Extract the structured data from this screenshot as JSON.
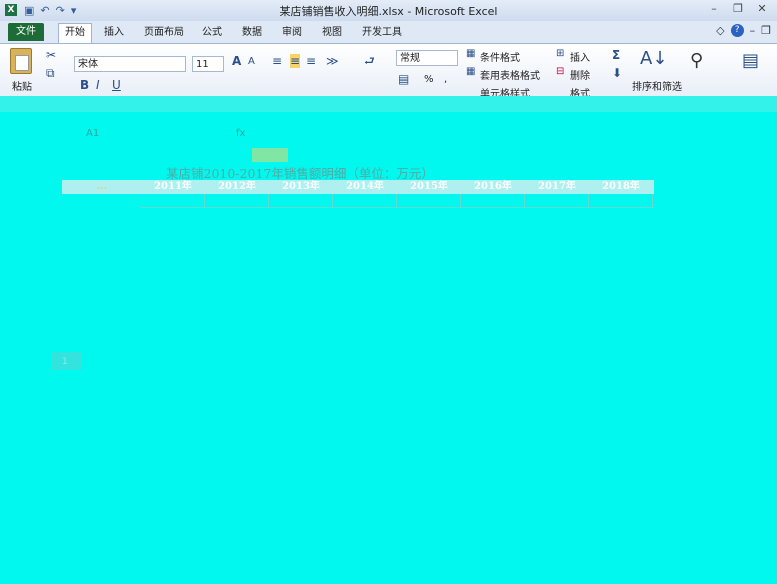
{
  "window": {
    "title": "某店铺销售收入明细.xlsx - Microsoft Excel",
    "app_icon": "X"
  },
  "qat": {
    "undo": "↶",
    "redo": "↷",
    "customize": "▾"
  },
  "tabs": [
    "文件",
    "开始",
    "插入",
    "页面布局",
    "公式",
    "数据",
    "审阅",
    "视图",
    "开发工具"
  ],
  "ribbon": {
    "paste_label": "粘贴",
    "font_name": "宋体",
    "font_size": "11",
    "number_format": "常规",
    "conditional_format": "条件格式",
    "table_format": "套用表格格式",
    "cell_style": "单元格样式",
    "insert": "插入",
    "delete": "删除",
    "format": "格式",
    "sort_filter": "排序和筛选",
    "percent": "%",
    "comma": ","
  },
  "sheet": {
    "title": "某店铺2010-2017年销售额明细（单位：万元）",
    "first_header": "...",
    "headers": [
      "2011年",
      "2012年",
      "2013年",
      "2014年",
      "2015年",
      "2016年",
      "2017年",
      "2018年"
    ],
    "faint_label": "1"
  },
  "colors": {
    "overlay": "#00f8ee",
    "file_tab": "#1d6c38",
    "header_row": "#aeeff0"
  }
}
